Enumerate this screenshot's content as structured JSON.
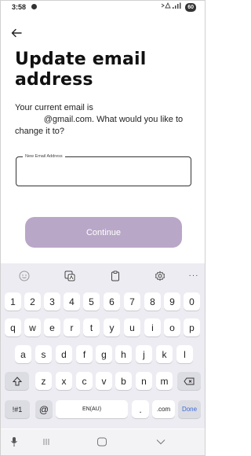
{
  "status_bar": {
    "time": "3:58",
    "signal_icons": "♪ ▲ .ıl",
    "battery": "60"
  },
  "page": {
    "title": "Update email address",
    "description": "Your current email is\n            @gmail.com. What would you like to change it to?",
    "email_field": {
      "label": "New Email Address",
      "value": "",
      "placeholder": ""
    },
    "continue_label": "Continue",
    "continue_color": "#b9a7c7"
  },
  "keyboard": {
    "toolbar_icons": [
      "emoji-icon",
      "translate-icon",
      "clipboard-icon",
      "settings-icon",
      "more-icon"
    ],
    "more_label": "···",
    "row1": [
      "1",
      "2",
      "3",
      "4",
      "5",
      "6",
      "7",
      "8",
      "9",
      "0"
    ],
    "row2": [
      "q",
      "w",
      "e",
      "r",
      "t",
      "y",
      "u",
      "i",
      "o",
      "p"
    ],
    "row3": [
      "a",
      "s",
      "d",
      "f",
      "g",
      "h",
      "j",
      "k",
      "l"
    ],
    "row4": [
      "z",
      "x",
      "c",
      "v",
      "b",
      "n",
      "m"
    ],
    "symbols_label": "!#1",
    "at_label": "@",
    "space_label": "EN(AU)",
    "dot_label": ".",
    "dotcom_label": ".com",
    "done_label": "Done",
    "done_color": "#3b6bd6"
  },
  "nav_bar": {
    "items": [
      "mic-icon",
      "recents-icon",
      "home-icon",
      "back-icon"
    ]
  }
}
